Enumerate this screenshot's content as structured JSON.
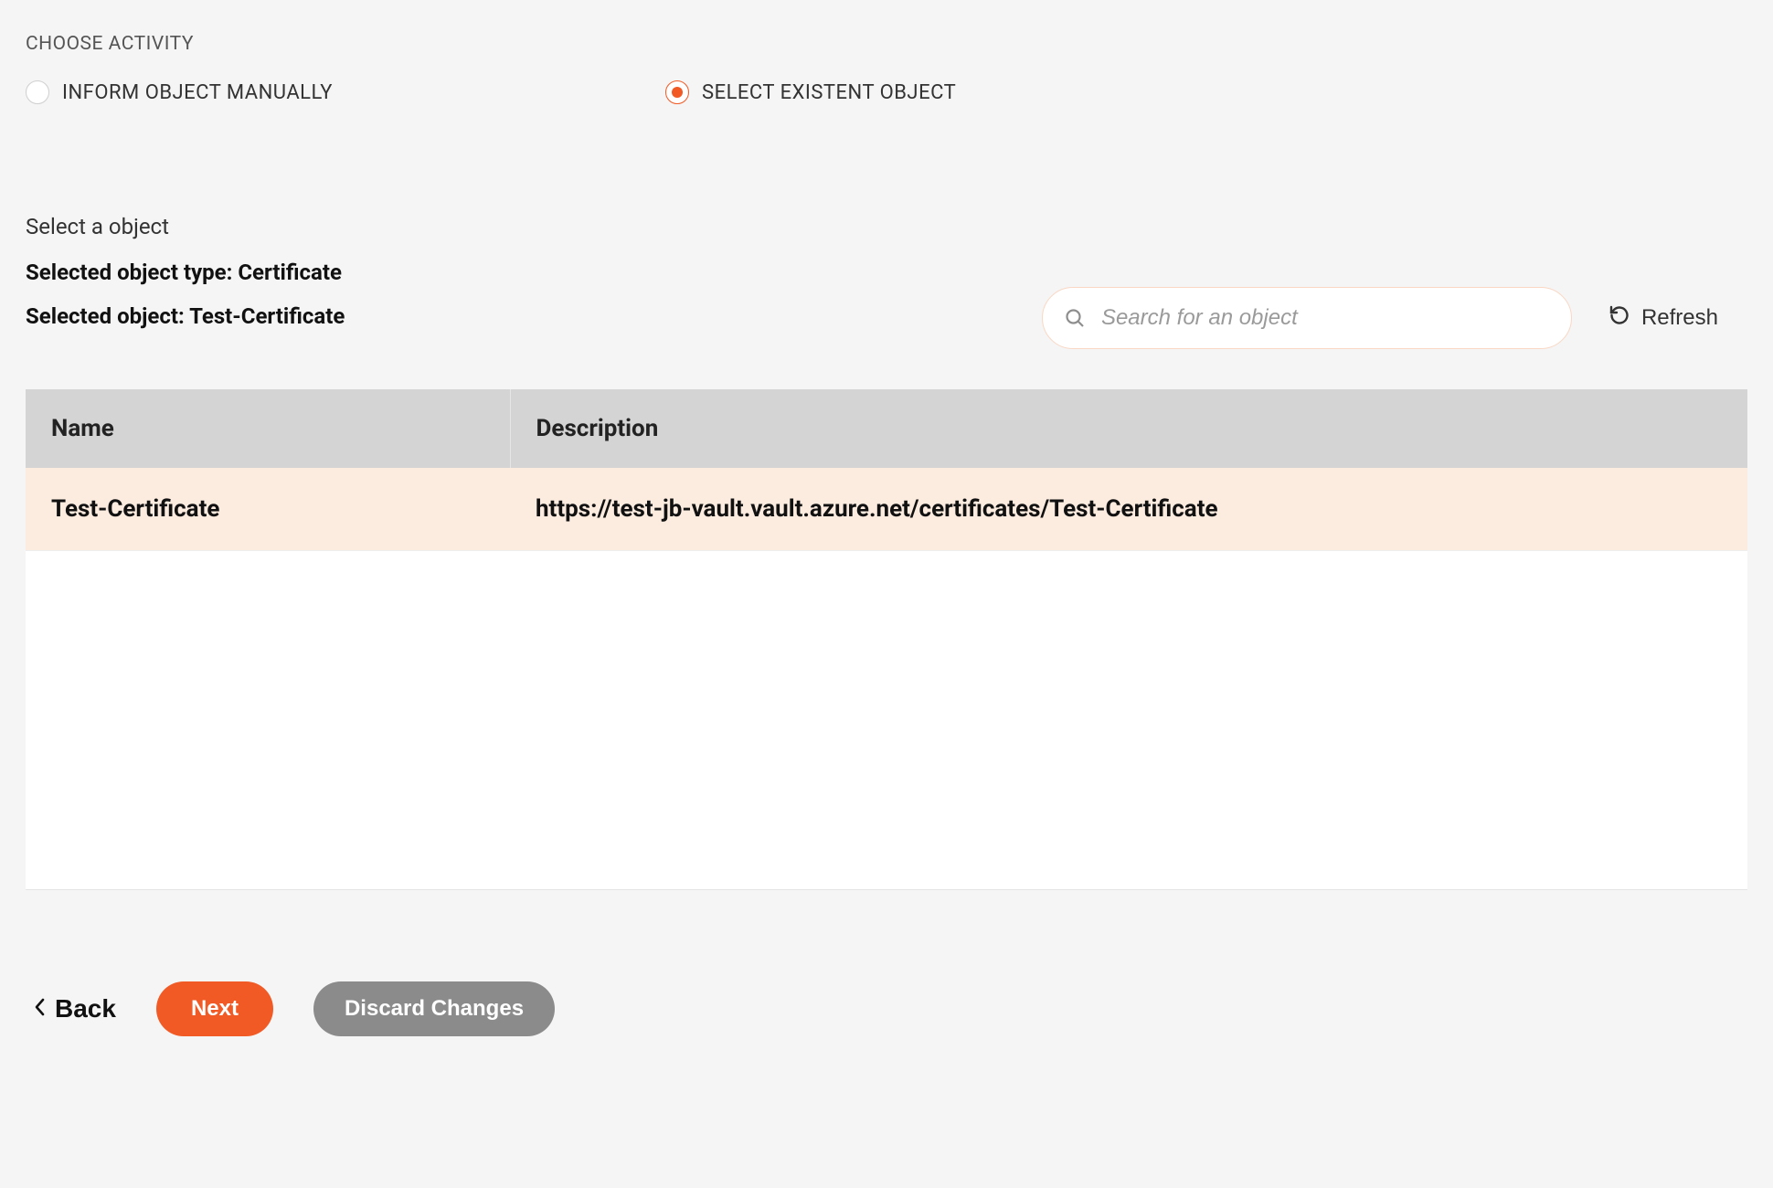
{
  "heading": "CHOOSE ACTIVITY",
  "radios": {
    "manual_label": "INFORM OBJECT MANUALLY",
    "existent_label": "SELECT EXISTENT OBJECT"
  },
  "select_label": "Select a object",
  "selected_type_line": "Selected object type: Certificate",
  "selected_object_line": "Selected object: Test-Certificate",
  "search": {
    "placeholder": "Search for an object"
  },
  "refresh_label": "Refresh",
  "table": {
    "headers": {
      "name": "Name",
      "description": "Description"
    },
    "rows": [
      {
        "name": "Test-Certificate",
        "description": "https://test-jb-vault.vault.azure.net/certificates/Test-Certificate"
      }
    ]
  },
  "footer": {
    "back": "Back",
    "next": "Next",
    "discard": "Discard Changes"
  }
}
